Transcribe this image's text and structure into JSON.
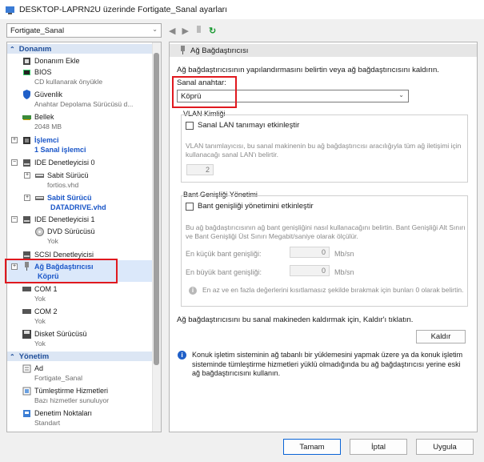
{
  "window": {
    "title": "DESKTOP-LAPRN2U üzerinde Fortigate_Sanal ayarları"
  },
  "vm_selector": {
    "value": "Fortigate_Sanal"
  },
  "sidebar": {
    "hardware_header": "Donanım",
    "items": [
      {
        "label": "Donanım Ekle"
      },
      {
        "label": "BIOS",
        "sub": "CD kullanarak önyükle"
      },
      {
        "label": "Güvenlik",
        "sub": "Anahtar Depolama Sürücüsü d..."
      },
      {
        "label": "Bellek",
        "sub": "2048 MB"
      },
      {
        "label": "İşlemci",
        "sub": "1 Sanal işlemci"
      },
      {
        "label": "IDE Denetleyicisi 0"
      },
      {
        "label": "Sabit Sürücü",
        "sub": "fortios.vhd"
      },
      {
        "label": "Sabit Sürücü",
        "sub": "DATADRIVE.vhd"
      },
      {
        "label": "IDE Denetleyicisi 1"
      },
      {
        "label": "DVD Sürücüsü",
        "sub": "Yok"
      },
      {
        "label": "SCSI Denetleyicisi"
      },
      {
        "label": "Ağ Bağdaştırıcısı",
        "sub": "Köprü"
      },
      {
        "label": "COM 1",
        "sub": "Yok"
      },
      {
        "label": "COM 2",
        "sub": "Yok"
      },
      {
        "label": "Disket Sürücüsü",
        "sub": "Yok"
      }
    ],
    "management_header": "Yönetim",
    "mgmt": [
      {
        "label": "Ad",
        "sub": "Fortigate_Sanal"
      },
      {
        "label": "Tümleştirme Hizmetleri",
        "sub": "Bazı hizmetler sunuluyor"
      },
      {
        "label": "Denetim Noktaları",
        "sub": "Standart"
      }
    ]
  },
  "panel": {
    "title": "Ağ Bağdaştırıcısı",
    "intro": "Ağ bağdaştırıcısının yapılandırmasını belirtin veya ağ bağdaştırıcısını kaldırın.",
    "switch_label": "Sanal anahtar:",
    "switch_value": "Köprü",
    "vlan_title": "VLAN Kimliği",
    "vlan_check": "Sanal LAN tanımayı etkinleştir",
    "vlan_desc": "VLAN tanımlayıcısı, bu sanal makinenin bu ağ bağdaştırıcısı aracılığıyla tüm ağ iletişimi için kullanacağı sanal LAN'ı belirtir.",
    "vlan_value": "2",
    "bw_title": "Bant Genişliği Yönetimi",
    "bw_check": "Bant genişliği yönetimini etkinleştir",
    "bw_desc": "Bu ağ bağdaştırıcısının ağ bant genişliğini nasıl kullanacağını belirtin. Bant Genişliği Alt Sınırı ve Bant Genişliği Üst Sınırı Megabit/saniye olarak ölçülür.",
    "min_label": "En küçük bant genişliği:",
    "min_value": "0",
    "max_label": "En büyük bant genişliği:",
    "max_value": "0",
    "unit": "Mb/sn",
    "bw_note": "En az ve en fazla değerlerini kısıtlamasız şekilde bırakmak için bunları 0 olarak belirtin.",
    "remove_text": "Ağ bağdaştırıcısını bu sanal makineden kaldırmak için, Kaldır'ı tıklatın.",
    "remove_button": "Kaldır",
    "info_text": "Konuk işletim sisteminin ağ tabanlı bir yüklemesini yapmak üzere ya da konuk işletim sisteminde tümleştirme hizmetleri yüklü olmadığında bu ağ bağdaştırıcısı yerine eski ağ bağdaştırıcısını kullanın."
  },
  "footer": {
    "ok": "Tamam",
    "cancel": "İptal",
    "apply": "Uygula"
  }
}
